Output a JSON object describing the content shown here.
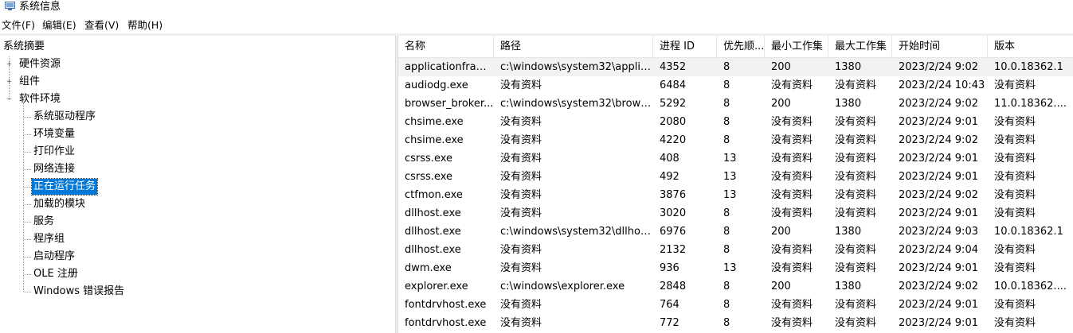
{
  "window": {
    "title": "系统信息"
  },
  "menu": [
    {
      "label": "文件(F)"
    },
    {
      "label": "编辑(E)"
    },
    {
      "label": "查看(V)"
    },
    {
      "label": "帮助(H)"
    }
  ],
  "tree": {
    "root": "系统摘要",
    "nodes": [
      {
        "label": "硬件资源",
        "expander": "+"
      },
      {
        "label": "组件",
        "expander": "+"
      },
      {
        "label": "软件环境",
        "expander": "−"
      }
    ],
    "children": [
      {
        "label": "系统驱动程序"
      },
      {
        "label": "环境变量"
      },
      {
        "label": "打印作业"
      },
      {
        "label": "网络连接"
      },
      {
        "label": "正在运行任务",
        "selected": true
      },
      {
        "label": "加载的模块"
      },
      {
        "label": "服务"
      },
      {
        "label": "程序组"
      },
      {
        "label": "启动程序"
      },
      {
        "label": "OLE 注册"
      },
      {
        "label": "Windows 错误报告"
      }
    ]
  },
  "table": {
    "columns": [
      "名称",
      "路径",
      "进程 ID",
      "优先顺...",
      "最小工作集",
      "最大工作集",
      "开始时间",
      "版本"
    ],
    "rows": [
      [
        "applicationframe...",
        "c:\\windows\\system32\\applic...",
        "4352",
        "8",
        "200",
        "1380",
        "2023/2/24 9:02",
        "10.0.18362.1"
      ],
      [
        "audiodg.exe",
        "没有资料",
        "6484",
        "8",
        "没有资料",
        "没有资料",
        "2023/2/24 10:43",
        "没有资料"
      ],
      [
        "browser_broker...",
        "c:\\windows\\system32\\brows...",
        "5292",
        "8",
        "200",
        "1380",
        "2023/2/24 9:02",
        "11.0.18362...."
      ],
      [
        "chsime.exe",
        "没有资料",
        "2080",
        "8",
        "没有资料",
        "没有资料",
        "2023/2/24 9:01",
        "没有资料"
      ],
      [
        "chsime.exe",
        "没有资料",
        "4220",
        "8",
        "没有资料",
        "没有资料",
        "2023/2/24 9:02",
        "没有资料"
      ],
      [
        "csrss.exe",
        "没有资料",
        "408",
        "13",
        "没有资料",
        "没有资料",
        "2023/2/24 9:01",
        "没有资料"
      ],
      [
        "csrss.exe",
        "没有资料",
        "492",
        "13",
        "没有资料",
        "没有资料",
        "2023/2/24 9:01",
        "没有资料"
      ],
      [
        "ctfmon.exe",
        "没有资料",
        "3876",
        "13",
        "没有资料",
        "没有资料",
        "2023/2/24 9:02",
        "没有资料"
      ],
      [
        "dllhost.exe",
        "没有资料",
        "3020",
        "8",
        "没有资料",
        "没有资料",
        "2023/2/24 9:01",
        "没有资料"
      ],
      [
        "dllhost.exe",
        "c:\\windows\\system32\\dllhost...",
        "6976",
        "8",
        "200",
        "1380",
        "2023/2/24 9:03",
        "10.0.18362.1"
      ],
      [
        "dllhost.exe",
        "没有资料",
        "2132",
        "8",
        "没有资料",
        "没有资料",
        "2023/2/24 9:04",
        "没有资料"
      ],
      [
        "dwm.exe",
        "没有资料",
        "936",
        "13",
        "没有资料",
        "没有资料",
        "2023/2/24 9:01",
        "没有资料"
      ],
      [
        "explorer.exe",
        "c:\\windows\\explorer.exe",
        "2848",
        "8",
        "200",
        "1380",
        "2023/2/24 9:02",
        "10.0.18362...."
      ],
      [
        "fontdrvhost.exe",
        "没有资料",
        "764",
        "8",
        "没有资料",
        "没有资料",
        "2023/2/24 9:01",
        "没有资料"
      ],
      [
        "fontdrvhost.exe",
        "没有资料",
        "772",
        "8",
        "没有资料",
        "没有资料",
        "2023/2/24 9:01",
        "没有资料"
      ]
    ]
  },
  "colors": {
    "selection": "#0078d7",
    "first_row": "#f2f2f2"
  }
}
